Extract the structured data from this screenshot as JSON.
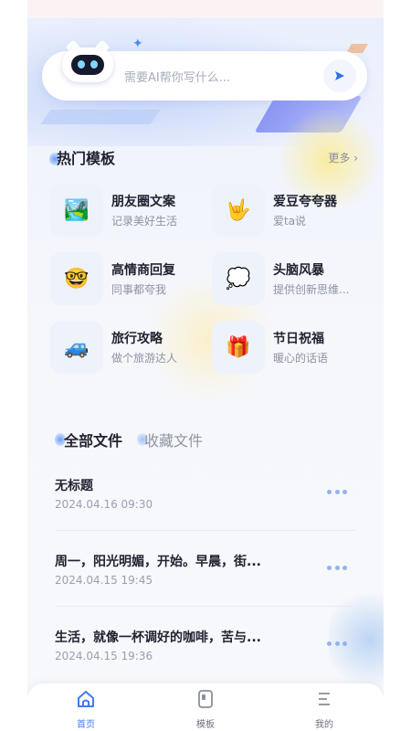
{
  "search": {
    "placeholder": "需要AI帮你写什么..."
  },
  "templates_section": {
    "title": "热门模板",
    "more": "更多 ›"
  },
  "templates": [
    {
      "title": "朋友圈文案",
      "sub": "记录美好生活",
      "icon": "landscape-picture-icon",
      "glyph": "🏞️"
    },
    {
      "title": "爱豆夸夸器",
      "sub": "爱ta说",
      "icon": "love-you-gesture-icon",
      "glyph": "🤟"
    },
    {
      "title": "高情商回复",
      "sub": "同事都夸我",
      "icon": "nerd-face-icon",
      "glyph": "🤓"
    },
    {
      "title": "头脑风暴",
      "sub": "提供创新思维...",
      "icon": "thought-bubble-icon",
      "glyph": "💭"
    },
    {
      "title": "旅行攻略",
      "sub": "做个旅游达人",
      "icon": "car-icon",
      "glyph": "🚙"
    },
    {
      "title": "节日祝福",
      "sub": "暖心的话语",
      "icon": "gift-icon",
      "glyph": "🎁"
    }
  ],
  "file_tabs": {
    "all": "全部文件",
    "favorites": "收藏文件"
  },
  "files": [
    {
      "title": "无标题",
      "date": "2024.04.16 09:30"
    },
    {
      "title": "周一，阳光明媚，开始。早晨，街...",
      "date": "2024.04.15 19:45"
    },
    {
      "title": "生活，就像一杯调好的咖啡，苦与...",
      "date": "2024.04.15 19:36"
    }
  ],
  "nav": {
    "home": "首页",
    "templates": "模板",
    "mine": "我的"
  },
  "colors": {
    "accent": "#3f7cf0",
    "text": "#1f2330",
    "muted": "#8d93a1"
  }
}
